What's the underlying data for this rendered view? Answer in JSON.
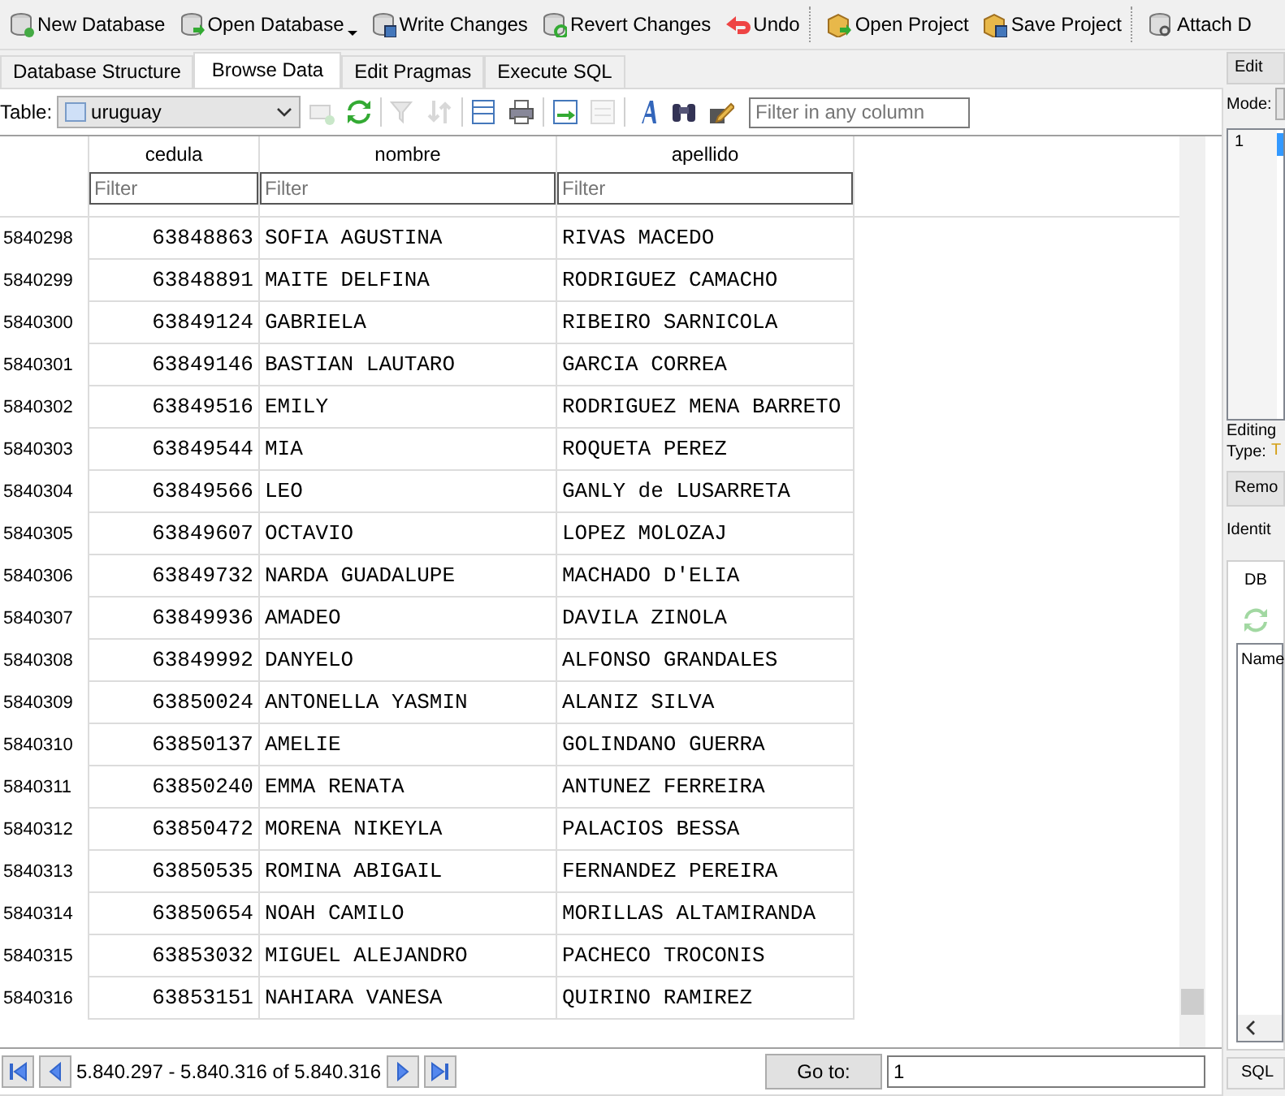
{
  "toolbar": [
    {
      "label": "New Database",
      "dropdown": false
    },
    {
      "label": "Open Database",
      "dropdown": true
    },
    {
      "label": "Write Changes",
      "dropdown": false
    },
    {
      "label": "Revert Changes",
      "dropdown": false
    },
    {
      "label": "Undo",
      "dropdown": false
    },
    {
      "label": "Open Project",
      "dropdown": false
    },
    {
      "label": "Save Project",
      "dropdown": false
    },
    {
      "label": "Attach D",
      "dropdown": false
    }
  ],
  "tabs": [
    {
      "label": "Database Structure",
      "selected": false
    },
    {
      "label": "Browse Data",
      "selected": true
    },
    {
      "label": "Edit Pragmas",
      "selected": false
    },
    {
      "label": "Execute SQL",
      "selected": false
    }
  ],
  "table_bar": {
    "label": "Table:",
    "table": "uruguay",
    "tools": [
      {
        "disabled": true
      },
      {
        "disabled": false
      },
      {
        "disabled": true
      },
      {
        "disabled": true
      },
      {
        "disabled": false
      },
      {
        "disabled": false
      },
      {
        "disabled": false
      },
      {
        "disabled": true
      },
      {
        "disabled": false
      },
      {
        "disabled": false
      },
      {
        "disabled": false
      }
    ],
    "filter_placeholder": "Filter in any column"
  },
  "grid": {
    "columns": [
      {
        "label": "cedula",
        "filter_placeholder": "Filter"
      },
      {
        "label": "nombre",
        "filter_placeholder": "Filter"
      },
      {
        "label": "apellido",
        "filter_placeholder": "Filter"
      }
    ],
    "rows": [
      {
        "number": "5840298",
        "cells": [
          "63848863",
          "SOFIA AGUSTINA",
          "RIVAS MACEDO"
        ]
      },
      {
        "number": "5840299",
        "cells": [
          "63848891",
          "MAITE DELFINA",
          "RODRIGUEZ CAMACHO"
        ]
      },
      {
        "number": "5840300",
        "cells": [
          "63849124",
          "GABRIELA",
          "RIBEIRO SARNICOLA"
        ]
      },
      {
        "number": "5840301",
        "cells": [
          "63849146",
          "BASTIAN LAUTARO",
          "GARCIA CORREA"
        ]
      },
      {
        "number": "5840302",
        "cells": [
          "63849516",
          "EMILY",
          "RODRIGUEZ MENA BARRETO"
        ]
      },
      {
        "number": "5840303",
        "cells": [
          "63849544",
          "MIA",
          "ROQUETA PEREZ"
        ]
      },
      {
        "number": "5840304",
        "cells": [
          "63849566",
          "LEO",
          "GANLY de LUSARRETA"
        ]
      },
      {
        "number": "5840305",
        "cells": [
          "63849607",
          "OCTAVIO",
          "LOPEZ MOLOZAJ"
        ]
      },
      {
        "number": "5840306",
        "cells": [
          "63849732",
          "NARDA GUADALUPE",
          "MACHADO D'ELIA"
        ]
      },
      {
        "number": "5840307",
        "cells": [
          "63849936",
          "AMADEO",
          "DAVILA ZINOLA"
        ]
      },
      {
        "number": "5840308",
        "cells": [
          "63849992",
          "DANYELO",
          "ALFONSO GRANDALES"
        ]
      },
      {
        "number": "5840309",
        "cells": [
          "63850024",
          "ANTONELLA YASMIN",
          "ALANIZ SILVA"
        ]
      },
      {
        "number": "5840310",
        "cells": [
          "63850137",
          "AMELIE",
          "GOLINDANO GUERRA"
        ]
      },
      {
        "number": "5840311",
        "cells": [
          "63850240",
          "EMMA RENATA",
          "ANTUNEZ FERREIRA"
        ]
      },
      {
        "number": "5840312",
        "cells": [
          "63850472",
          "MORENA NIKEYLA",
          "PALACIOS BESSA"
        ]
      },
      {
        "number": "5840313",
        "cells": [
          "63850535",
          "ROMINA ABIGAIL",
          "FERNANDEZ PEREIRA"
        ]
      },
      {
        "number": "5840314",
        "cells": [
          "63850654",
          "NOAH CAMILO",
          "MORILLAS ALTAMIRANDA"
        ]
      },
      {
        "number": "5840315",
        "cells": [
          "63853032",
          "MIGUEL ALEJANDRO",
          "PACHECO TROCONIS"
        ]
      },
      {
        "number": "5840316",
        "cells": [
          "63853151",
          "NAHIARA VANESA",
          "QUIRINO RAMIREZ"
        ]
      }
    ]
  },
  "navigation": {
    "range": "5.840.297 - 5.840.316 of 5.840.316",
    "goto_label": "Go to:",
    "goto_value": "1"
  },
  "edit_panel": {
    "title": "Edit",
    "mode_label": "Mode:",
    "line_number": "1",
    "editing_label": "Editing",
    "type_label": "Type:",
    "type_value": "T",
    "remove_button": "Remo",
    "identity_label": "Identit",
    "dock_tab": "DB",
    "name_header": "Name",
    "bottom_tab": "SQL"
  }
}
